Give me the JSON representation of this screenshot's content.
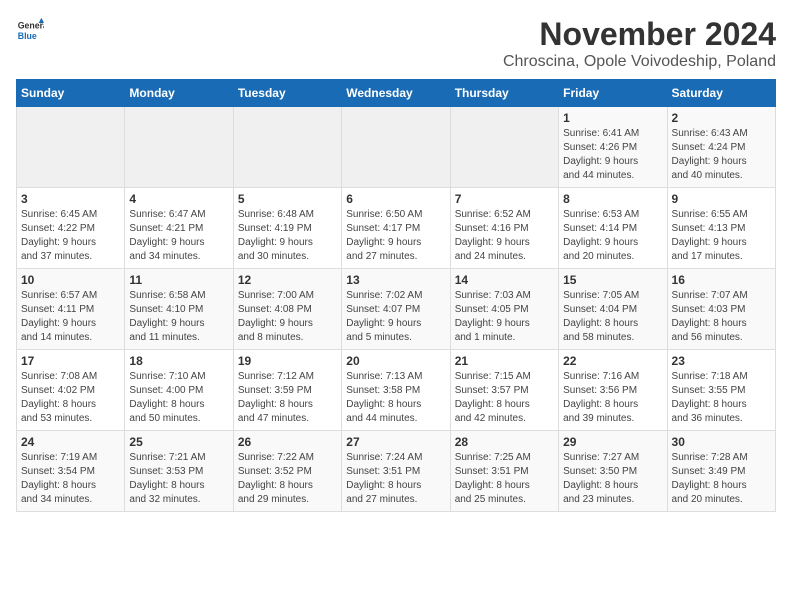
{
  "logo": {
    "general": "General",
    "blue": "Blue"
  },
  "header": {
    "title": "November 2024",
    "subtitle": "Chroscina, Opole Voivodeship, Poland"
  },
  "weekdays": [
    "Sunday",
    "Monday",
    "Tuesday",
    "Wednesday",
    "Thursday",
    "Friday",
    "Saturday"
  ],
  "weeks": [
    [
      {
        "day": "",
        "info": ""
      },
      {
        "day": "",
        "info": ""
      },
      {
        "day": "",
        "info": ""
      },
      {
        "day": "",
        "info": ""
      },
      {
        "day": "",
        "info": ""
      },
      {
        "day": "1",
        "info": "Sunrise: 6:41 AM\nSunset: 4:26 PM\nDaylight: 9 hours\nand 44 minutes."
      },
      {
        "day": "2",
        "info": "Sunrise: 6:43 AM\nSunset: 4:24 PM\nDaylight: 9 hours\nand 40 minutes."
      }
    ],
    [
      {
        "day": "3",
        "info": "Sunrise: 6:45 AM\nSunset: 4:22 PM\nDaylight: 9 hours\nand 37 minutes."
      },
      {
        "day": "4",
        "info": "Sunrise: 6:47 AM\nSunset: 4:21 PM\nDaylight: 9 hours\nand 34 minutes."
      },
      {
        "day": "5",
        "info": "Sunrise: 6:48 AM\nSunset: 4:19 PM\nDaylight: 9 hours\nand 30 minutes."
      },
      {
        "day": "6",
        "info": "Sunrise: 6:50 AM\nSunset: 4:17 PM\nDaylight: 9 hours\nand 27 minutes."
      },
      {
        "day": "7",
        "info": "Sunrise: 6:52 AM\nSunset: 4:16 PM\nDaylight: 9 hours\nand 24 minutes."
      },
      {
        "day": "8",
        "info": "Sunrise: 6:53 AM\nSunset: 4:14 PM\nDaylight: 9 hours\nand 20 minutes."
      },
      {
        "day": "9",
        "info": "Sunrise: 6:55 AM\nSunset: 4:13 PM\nDaylight: 9 hours\nand 17 minutes."
      }
    ],
    [
      {
        "day": "10",
        "info": "Sunrise: 6:57 AM\nSunset: 4:11 PM\nDaylight: 9 hours\nand 14 minutes."
      },
      {
        "day": "11",
        "info": "Sunrise: 6:58 AM\nSunset: 4:10 PM\nDaylight: 9 hours\nand 11 minutes."
      },
      {
        "day": "12",
        "info": "Sunrise: 7:00 AM\nSunset: 4:08 PM\nDaylight: 9 hours\nand 8 minutes."
      },
      {
        "day": "13",
        "info": "Sunrise: 7:02 AM\nSunset: 4:07 PM\nDaylight: 9 hours\nand 5 minutes."
      },
      {
        "day": "14",
        "info": "Sunrise: 7:03 AM\nSunset: 4:05 PM\nDaylight: 9 hours\nand 1 minute."
      },
      {
        "day": "15",
        "info": "Sunrise: 7:05 AM\nSunset: 4:04 PM\nDaylight: 8 hours\nand 58 minutes."
      },
      {
        "day": "16",
        "info": "Sunrise: 7:07 AM\nSunset: 4:03 PM\nDaylight: 8 hours\nand 56 minutes."
      }
    ],
    [
      {
        "day": "17",
        "info": "Sunrise: 7:08 AM\nSunset: 4:02 PM\nDaylight: 8 hours\nand 53 minutes."
      },
      {
        "day": "18",
        "info": "Sunrise: 7:10 AM\nSunset: 4:00 PM\nDaylight: 8 hours\nand 50 minutes."
      },
      {
        "day": "19",
        "info": "Sunrise: 7:12 AM\nSunset: 3:59 PM\nDaylight: 8 hours\nand 47 minutes."
      },
      {
        "day": "20",
        "info": "Sunrise: 7:13 AM\nSunset: 3:58 PM\nDaylight: 8 hours\nand 44 minutes."
      },
      {
        "day": "21",
        "info": "Sunrise: 7:15 AM\nSunset: 3:57 PM\nDaylight: 8 hours\nand 42 minutes."
      },
      {
        "day": "22",
        "info": "Sunrise: 7:16 AM\nSunset: 3:56 PM\nDaylight: 8 hours\nand 39 minutes."
      },
      {
        "day": "23",
        "info": "Sunrise: 7:18 AM\nSunset: 3:55 PM\nDaylight: 8 hours\nand 36 minutes."
      }
    ],
    [
      {
        "day": "24",
        "info": "Sunrise: 7:19 AM\nSunset: 3:54 PM\nDaylight: 8 hours\nand 34 minutes."
      },
      {
        "day": "25",
        "info": "Sunrise: 7:21 AM\nSunset: 3:53 PM\nDaylight: 8 hours\nand 32 minutes."
      },
      {
        "day": "26",
        "info": "Sunrise: 7:22 AM\nSunset: 3:52 PM\nDaylight: 8 hours\nand 29 minutes."
      },
      {
        "day": "27",
        "info": "Sunrise: 7:24 AM\nSunset: 3:51 PM\nDaylight: 8 hours\nand 27 minutes."
      },
      {
        "day": "28",
        "info": "Sunrise: 7:25 AM\nSunset: 3:51 PM\nDaylight: 8 hours\nand 25 minutes."
      },
      {
        "day": "29",
        "info": "Sunrise: 7:27 AM\nSunset: 3:50 PM\nDaylight: 8 hours\nand 23 minutes."
      },
      {
        "day": "30",
        "info": "Sunrise: 7:28 AM\nSunset: 3:49 PM\nDaylight: 8 hours\nand 20 minutes."
      }
    ]
  ]
}
